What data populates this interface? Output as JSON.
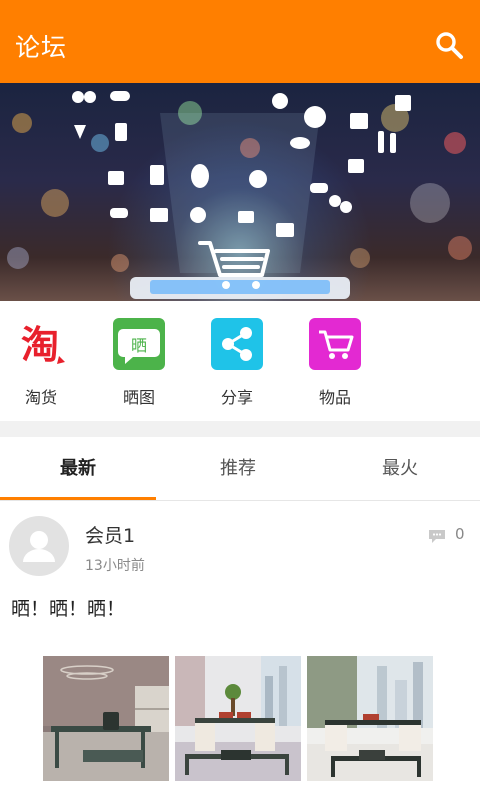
{
  "header": {
    "title": "论坛",
    "search_icon": "search-icon"
  },
  "banner": {
    "icons": [
      "shopping-cart-icon",
      "food-icons"
    ]
  },
  "quick_links": [
    {
      "label": "淘货",
      "icon": "taobao-icon",
      "color": "#e8202c"
    },
    {
      "label": "晒图",
      "icon": "chat-bubble-icon",
      "color": "#4cb34a"
    },
    {
      "label": "分享",
      "icon": "share-icon",
      "color": "#1fc3e8"
    },
    {
      "label": "物品",
      "icon": "cart-icon",
      "color": "#e329d2"
    }
  ],
  "tabs": [
    {
      "label": "最新",
      "active": true
    },
    {
      "label": "推荐",
      "active": false
    },
    {
      "label": "最火",
      "active": false
    }
  ],
  "post": {
    "username": "会员1",
    "time": "13小时前",
    "comment_count": "0",
    "text": "晒！晒！晒！",
    "photos": [
      "office-desk-photo",
      "office-workstation-photo",
      "office-workstation-photo"
    ]
  },
  "colors": {
    "accent": "#ff7f00"
  }
}
